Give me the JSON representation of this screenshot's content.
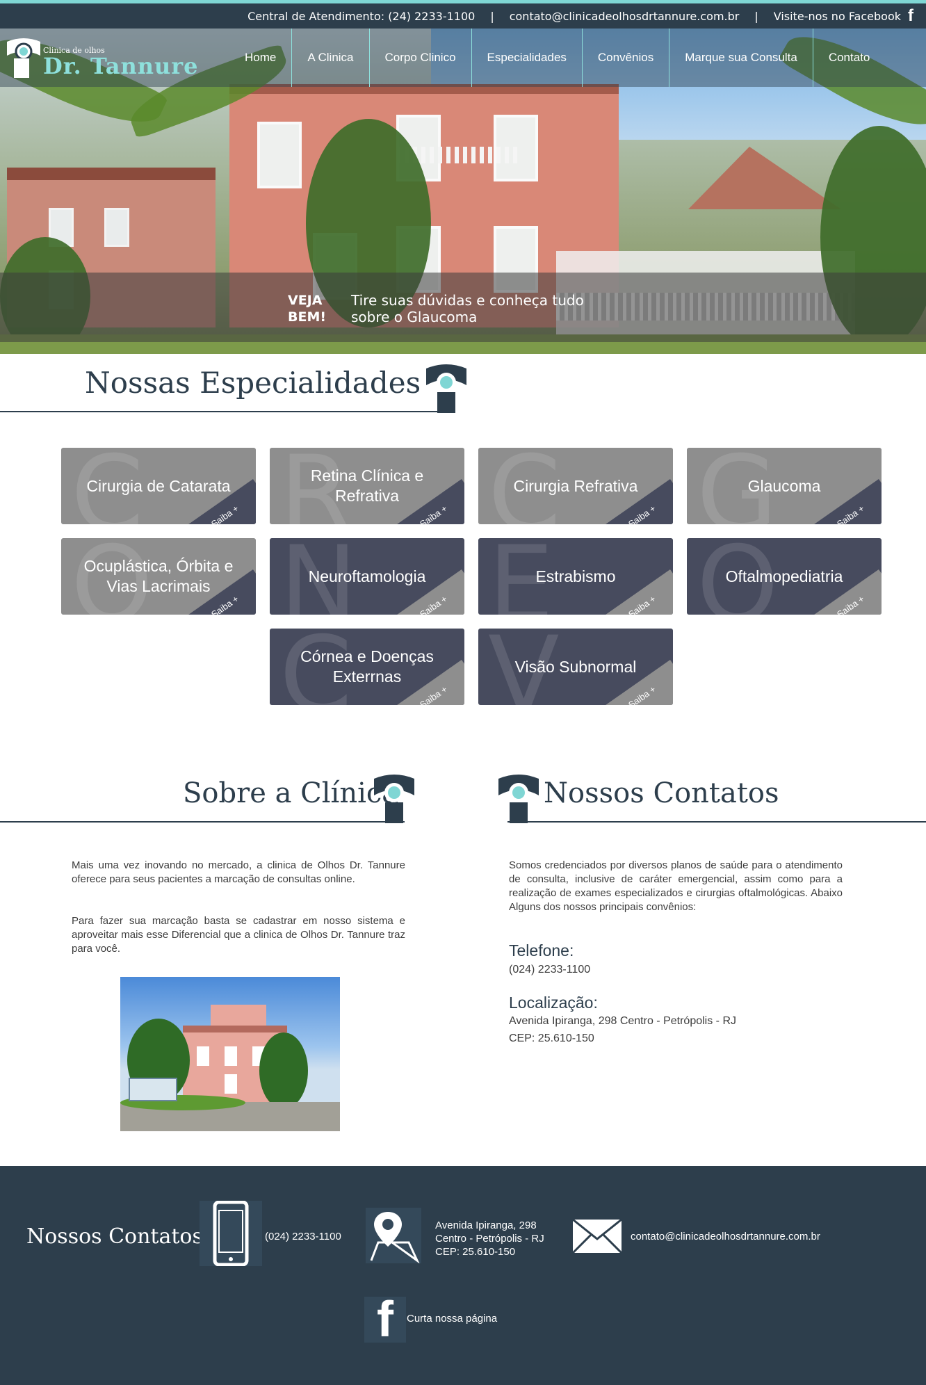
{
  "topbar": {
    "central": "Central de Atendimento: (24) 2233-1100",
    "separator": "|",
    "email": "contato@clinicadeolhosdrtannure.com.br",
    "facebook": "Visite-nos no Facebook",
    "facebook_icon": "f"
  },
  "logo": {
    "small": "Clinica de olhos",
    "big": "Dr. Tannure"
  },
  "nav": {
    "items": [
      "Home",
      "A Clinica",
      "Corpo Clinico",
      "Especialidades",
      "Convênios",
      "Marque sua Consulta",
      "Contato"
    ]
  },
  "banner": {
    "label_line1": "VEJA",
    "label_line2": "BEM!",
    "text_line1": "Tire suas dúvidas e conheça tudo",
    "text_line2": "sobre o Glaucoma"
  },
  "especialidades": {
    "title": "Nossas Especialidades",
    "saiba": "Saiba +",
    "tiles": [
      {
        "label": "Cirurgia de Catarata",
        "letter": "C",
        "style": "gray"
      },
      {
        "label": "Retina Clínica e Refrativa",
        "letter": "R",
        "style": "gray"
      },
      {
        "label": "Cirurgia Refrativa",
        "letter": "C",
        "style": "gray"
      },
      {
        "label": "Glaucoma",
        "letter": "G",
        "style": "gray"
      },
      {
        "label": "Ocuplástica, Órbita e Vias Lacrimais",
        "letter": "O",
        "style": "gray"
      },
      {
        "label": "Neuroftamologia",
        "letter": "N",
        "style": "dark"
      },
      {
        "label": "Estrabismo",
        "letter": "E",
        "style": "dark"
      },
      {
        "label": "Oftalmopediatria",
        "letter": "O",
        "style": "dark"
      },
      {
        "label": "Córnea e Doenças Exterrnas",
        "letter": "C",
        "style": "dark"
      },
      {
        "label": "Visão Subnormal",
        "letter": "V",
        "style": "dark"
      }
    ]
  },
  "sobre": {
    "title": "Sobre a Clínica",
    "p1": "Mais uma vez inovando no mercado, a clinica de Olhos Dr. Tannure oferece para seus pacientes a marcação de consultas online.",
    "p2": "Para fazer sua marcação basta se cadastrar em nosso sistema e aproveitar mais esse Diferencial que a clinica de Olhos Dr. Tannure traz para você."
  },
  "contatos": {
    "title": "Nossos Contatos",
    "intro": "Somos credenciados por diversos planos de saúde para o atendimento de consulta, inclusive de caráter emergencial, assim como para a realização de exames especializados e cirurgias oftalmológicas. Abaixo Alguns dos nossos principais convênios:",
    "telefone_label": "Telefone:",
    "telefone": "(024) 2233-1100",
    "localizacao_label": "Localização:",
    "endereco": "Avenida Ipiranga, 298 Centro - Petrópolis - RJ",
    "cep": "CEP: 25.610-150"
  },
  "footer": {
    "title": "Nossos Contatos",
    "phone": "(024) 2233-1100",
    "addr1": "Avenida Ipiranga, 298",
    "addr2": "Centro - Petrópolis - RJ",
    "addr3": "CEP: 25.610-150",
    "email": "contato@clinicadeolhosdrtannure.com.br",
    "facebook": "Curta nossa página",
    "facebook_icon": "f"
  },
  "colors": {
    "accent": "#7fd6d4",
    "navy": "#2d3e4c",
    "tile_gray": "#8e8e8e",
    "tile_dark": "#474b5e"
  }
}
